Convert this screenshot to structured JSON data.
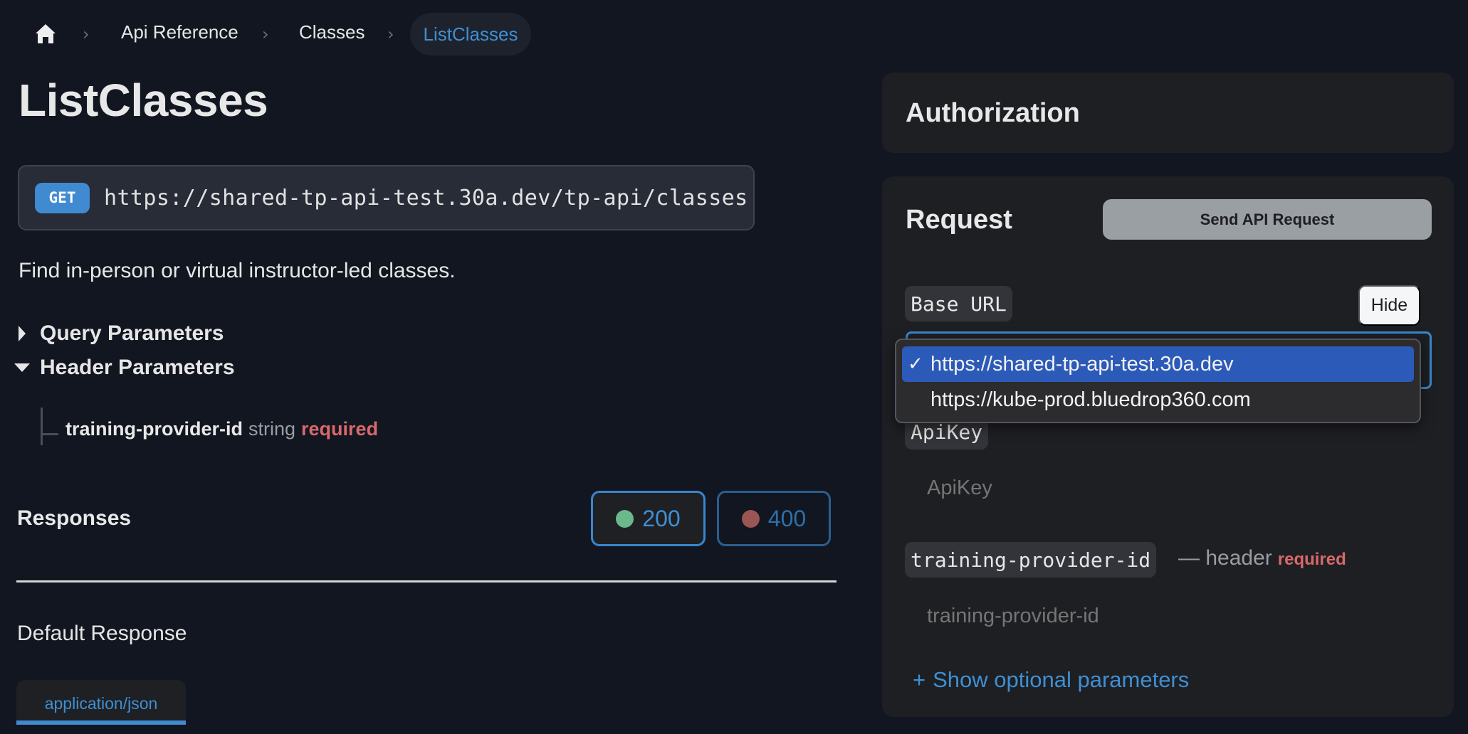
{
  "breadcrumb": {
    "home_icon": "home-icon",
    "items": [
      "Api Reference",
      "Classes"
    ],
    "current": "ListClasses",
    "separator": "›"
  },
  "page": {
    "title": "ListClasses",
    "method": "GET",
    "endpoint_url": "https://shared-tp-api-test.30a.dev/tp-api/classes",
    "description": "Find in-person or virtual instructor-led classes."
  },
  "sections": {
    "query_parameters": {
      "label": "Query Parameters",
      "expanded": false
    },
    "header_parameters": {
      "label": "Header Parameters",
      "expanded": true,
      "params": [
        {
          "name": "training-provider-id",
          "type": "string",
          "required_label": "required"
        }
      ]
    }
  },
  "responses": {
    "label": "Responses",
    "codes": [
      {
        "code": "200",
        "status_color": "#6bb88a",
        "selected": true
      },
      {
        "code": "400",
        "status_color": "#9a5555",
        "selected": false
      }
    ],
    "default_label": "Default Response",
    "content_type_tab": "application/json"
  },
  "authorization": {
    "title": "Authorization"
  },
  "request": {
    "title": "Request",
    "send_button": "Send API Request",
    "base_url": {
      "label": "Base URL",
      "hide_button": "Hide",
      "options": [
        {
          "value": "https://shared-tp-api-test.30a.dev",
          "selected": true,
          "check": "✓"
        },
        {
          "value": "https://kube-prod.bluedrop360.com",
          "selected": false
        }
      ]
    },
    "apikey": {
      "label": "ApiKey",
      "placeholder": "ApiKey",
      "value": ""
    },
    "training_provider_id": {
      "label": "training-provider-id",
      "location": "— header",
      "required_label": "required",
      "placeholder": "training-provider-id",
      "value": ""
    },
    "show_optional": {
      "icon": "+",
      "label": "Show optional parameters"
    }
  },
  "colors": {
    "accent": "#3f8fd4",
    "required": "#d8696a",
    "background": "#111620",
    "panel": "#1e1f23"
  }
}
